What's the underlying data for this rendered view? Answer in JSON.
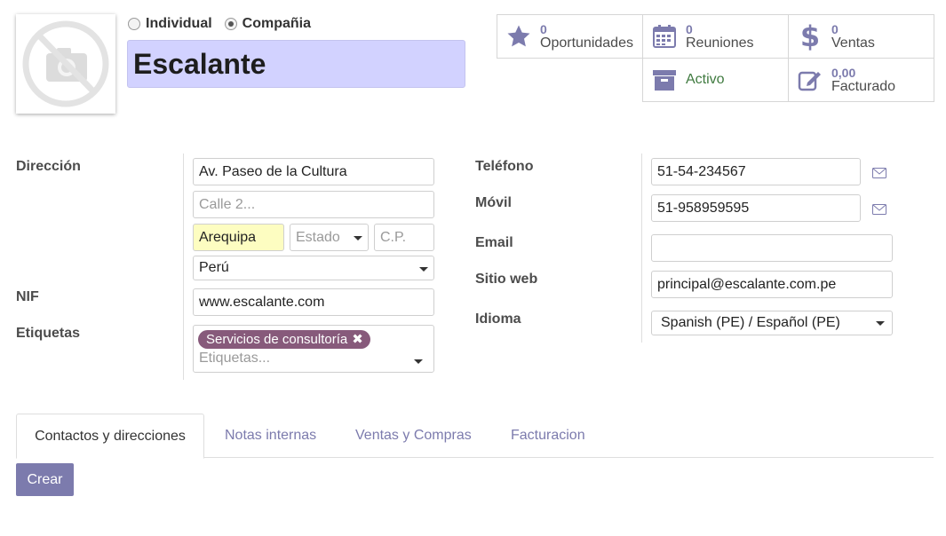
{
  "header": {
    "company_type": {
      "individual_label": "Individual",
      "company_label": "Compañia",
      "selected": "company"
    },
    "name": "Escalante"
  },
  "smart_buttons": {
    "opportunities": {
      "count": "0",
      "label": "Oportunidades",
      "icon": "star-icon"
    },
    "meetings": {
      "count": "0",
      "label": "Reuniones",
      "icon": "calendar-icon"
    },
    "sales": {
      "count": "0",
      "label": "Ventas",
      "icon": "dollar-icon"
    },
    "active": {
      "label": "Activo",
      "icon": "archive-icon"
    },
    "invoiced": {
      "count": "0,00",
      "label": "Facturado",
      "icon": "pencil-square-icon"
    }
  },
  "form": {
    "address_label": "Dirección",
    "street": "Av. Paseo de la Cultura",
    "street2_placeholder": "Calle 2...",
    "city": "Arequipa",
    "state_placeholder": "Estado",
    "zip_placeholder": "C.P.",
    "country": "Perú",
    "vat_label": "NIF",
    "vat": "www.escalante.com",
    "tags_label": "Etiquetas",
    "tags": [
      "Servicios de consultoría"
    ],
    "tags_placeholder": "Etiquetas...",
    "phone_label": "Teléfono",
    "phone": "51-54-234567",
    "mobile_label": "Móvil",
    "mobile": "51-958959595",
    "email_label": "Email",
    "email": "",
    "website_label": "Sitio web",
    "website": "principal@escalante.com.pe",
    "language_label": "Idioma",
    "language": "Spanish (PE) / Español (PE)"
  },
  "tabs": [
    {
      "label": "Contactos y direcciones",
      "active": true
    },
    {
      "label": "Notas internas",
      "active": false
    },
    {
      "label": "Ventas y Compras",
      "active": false
    },
    {
      "label": "Facturacion",
      "active": false
    }
  ],
  "actions": {
    "create_label": "Crear"
  },
  "colors": {
    "accent": "#7c7bad",
    "tag": "#875a7b",
    "name_bg": "#d2d2ff",
    "city_bg": "#fdfdc1",
    "active_green": "#3f7a3f"
  }
}
